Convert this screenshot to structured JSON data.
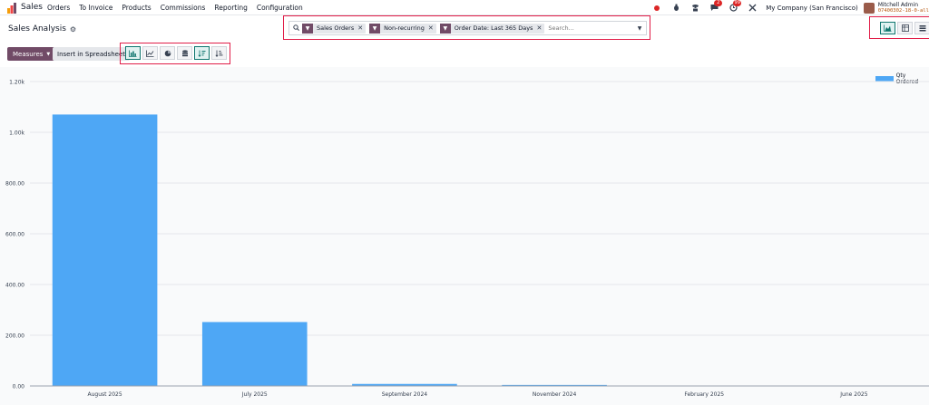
{
  "nav": {
    "app_name": "Sales",
    "menu": [
      "Orders",
      "To Invoice",
      "Products",
      "Commissions",
      "Reporting",
      "Configuration"
    ],
    "activity_badge": "2",
    "messages_badge": "99",
    "company": "My Company (San Francisco)",
    "user_name": "Mitchell Admin",
    "db_name": "07400302-18-0-all"
  },
  "control": {
    "title": "Sales Analysis",
    "facets": [
      {
        "label": "Sales Orders"
      },
      {
        "label": "Non-recurring"
      },
      {
        "label": "Order Date: Last 365 Days"
      }
    ],
    "search_placeholder": "Search...",
    "measures_label": "Measures",
    "insert_label": "Insert in Spreadsheet"
  },
  "icons": {
    "bar_chart": "bar-chart-icon",
    "line_chart": "line-chart-icon",
    "pie_chart": "pie-chart-icon",
    "stacked": "stacked-icon",
    "descending": "sort-descending-icon",
    "ascending": "sort-ascending-icon",
    "graph_view": "graph-view-icon",
    "pivot_view": "pivot-view-icon",
    "list_view": "list-view-icon"
  },
  "colors": {
    "brand": "#714b67",
    "bar": "#4ea7f5",
    "annotation": "#e11d48"
  },
  "chart_data": {
    "type": "bar",
    "categories": [
      "August 2025",
      "July 2025",
      "September 2024",
      "November 2024",
      "February 2025",
      "June 2025"
    ],
    "series": [
      {
        "name": "Qty Ordered",
        "values": [
          1070,
          252,
          8,
          4,
          0,
          0
        ]
      }
    ],
    "yticks": [
      "0.00",
      "200.00",
      "400.00",
      "600.00",
      "800.00",
      "1.00k",
      "1.20k"
    ],
    "ylim": [
      0,
      1200
    ],
    "grid": true,
    "legend": "top-right"
  }
}
